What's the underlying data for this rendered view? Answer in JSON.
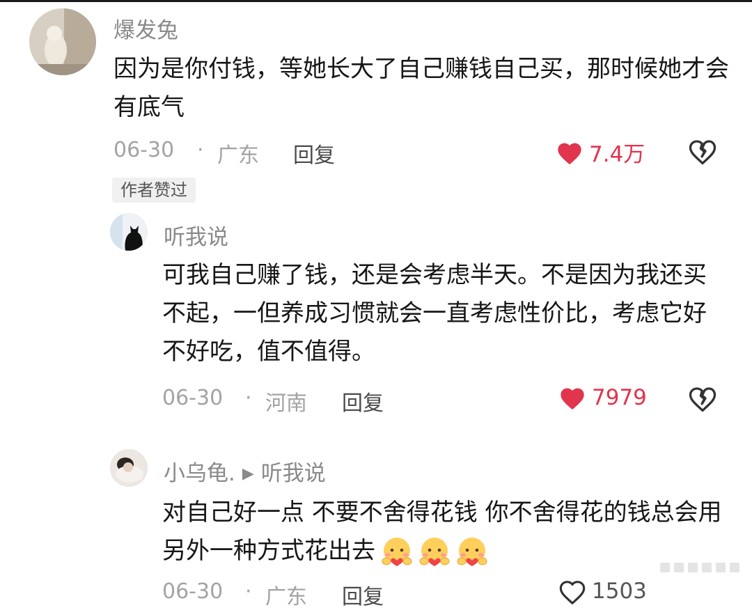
{
  "comments": [
    {
      "username": "爆发兔",
      "text": "因为是你付钱，等她长大了自己赚钱自己买，那时候她才会有底气",
      "date": "06-30",
      "location": "广东",
      "reply_label": "回复",
      "likes": "7.4万",
      "badge": "作者赞过"
    },
    {
      "username": "听我说",
      "text": "可我自己赚了钱，还是会考虑半天。不是因为我还买不起，一但养成习惯就会一直考虑性价比，考虑它好不好吃，值不值得。",
      "date": "06-30",
      "location": "河南",
      "reply_label": "回复",
      "likes": "7979"
    },
    {
      "username": "小乌龟.",
      "reply_to": "听我说",
      "text": "对自己好一点 不要不舍得花钱 你不舍得花的钱总会用另外一种方式花出去",
      "date": "06-30",
      "location": "广东",
      "reply_label": "回复",
      "likes": "1503"
    }
  ],
  "separator": "·",
  "icons": {
    "like": "heart-filled-icon",
    "dislike": "broken-heart-icon",
    "emoji": "hugging-face-emoji"
  },
  "colors": {
    "accent_like": "#e1344d",
    "meta_gray": "#a3a3a3",
    "username_gray": "#8a8a8a"
  }
}
